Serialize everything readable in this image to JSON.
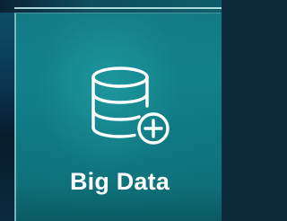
{
  "tile": {
    "label": "Big Data",
    "icon": "database-plus-icon"
  },
  "colors": {
    "tile_accent": "#118089",
    "text": "#ffffff"
  }
}
